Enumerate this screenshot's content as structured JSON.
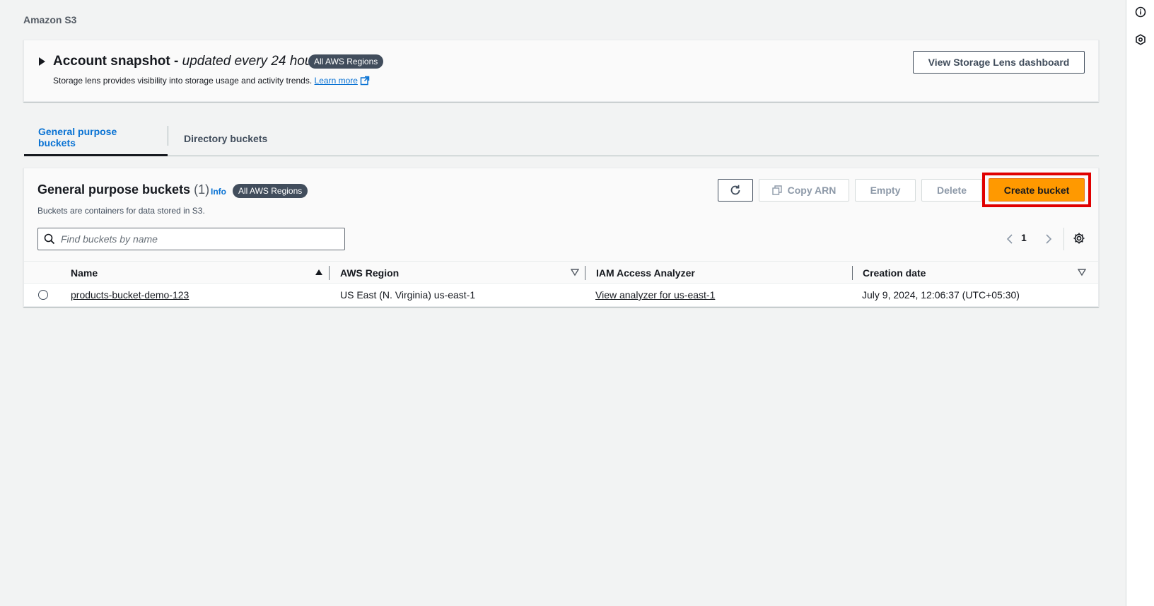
{
  "breadcrumb": {
    "label": "Amazon S3"
  },
  "snapshot": {
    "title": "Account snapshot - ",
    "subtitle": "updated every 24 hours",
    "badge": "All AWS Regions",
    "description": "Storage lens provides visibility into storage usage and activity trends.",
    "learn_more": "Learn more",
    "lens_button": "View Storage Lens dashboard"
  },
  "tabs": [
    {
      "label": "General purpose buckets"
    },
    {
      "label": "Directory buckets"
    }
  ],
  "panel": {
    "title": "General purpose buckets",
    "count": "(1)",
    "info": "Info",
    "badge": "All AWS Regions",
    "description": "Buckets are containers for data stored in S3.",
    "actions": {
      "copy_arn": "Copy ARN",
      "empty": "Empty",
      "delete": "Delete",
      "create": "Create bucket"
    },
    "search": {
      "placeholder": "Find buckets by name",
      "value": ""
    },
    "pager": {
      "page": "1"
    }
  },
  "table": {
    "columns": [
      "Name",
      "AWS Region",
      "IAM Access Analyzer",
      "Creation date"
    ],
    "rows": [
      {
        "name": "products-bucket-demo-123",
        "region": "US East (N. Virginia) us-east-1",
        "analyzer": "View analyzer for us-east-1",
        "created": "July 9, 2024, 12:06:37 (UTC+05:30)"
      }
    ]
  },
  "colors": {
    "primary_button": "#ff9900",
    "link": "#0972d3",
    "badge": "#414d5c",
    "highlight": "#e00000"
  },
  "icons": [
    "info-icon",
    "settings-hex-icon",
    "external-link-icon",
    "refresh-icon",
    "copy-icon",
    "search-icon",
    "chevron-left-icon",
    "chevron-right-icon",
    "gear-icon",
    "sort-asc-icon",
    "sort-desc-icon"
  ]
}
